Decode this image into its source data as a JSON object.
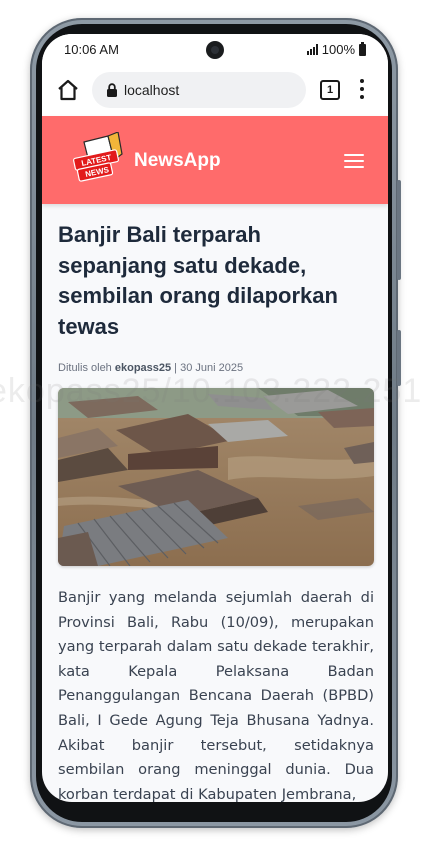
{
  "status": {
    "time": "10:06 AM",
    "battery": "100%"
  },
  "browser": {
    "url": "localhost",
    "tab_count": "1"
  },
  "app": {
    "brand": "NewsApp",
    "logo_text_1": "LATEST",
    "logo_text_2": "NEWS"
  },
  "article": {
    "title": "Banjir Bali terparah sepanjang satu dekade, sembilan orang dilaporkan tewas",
    "meta_prefix": "Ditulis oleh ",
    "author": "ekopass25",
    "meta_sep": " | ",
    "date": "30 Juni 2025",
    "body": "Banjir yang melanda sejumlah daerah di Provinsi Bali, Rabu (10/09), merupakan yang terparah dalam satu dekade terakhir, kata Kepala Pelaksana Badan Penanggulangan Bencana Daerah (BPBD) Bali, I Gede Agung Teja Bhusana Yadnya. Akibat banjir tersebut, setidaknya sembilan orang meninggal dunia. Dua korban terdapat di Kabupaten Jembrana,"
  },
  "watermark": "ekopass25/10.103.222.251",
  "colors": {
    "header": "#ff6b6b",
    "title": "#1e2a3b",
    "body": "#3a4351"
  },
  "icons": [
    "home-icon",
    "lock-icon",
    "tabs-icon",
    "more-vert-icon",
    "hamburger-menu-icon",
    "news-logo-icon"
  ]
}
